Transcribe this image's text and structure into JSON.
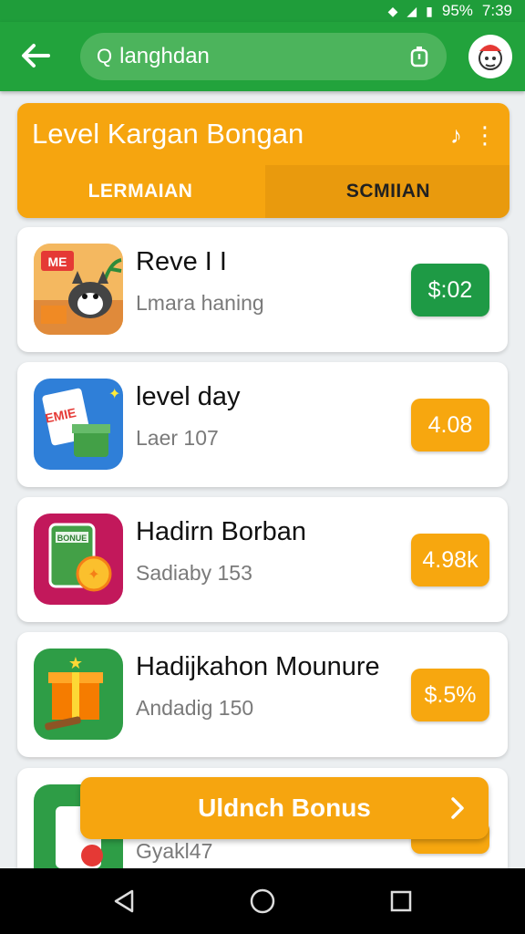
{
  "status_bar": {
    "battery": "95%",
    "time": "7:39"
  },
  "app_bar": {
    "search_value": "langhdan"
  },
  "header": {
    "title": "Level Kargan Bongan",
    "tabs": [
      {
        "label": "LERMAIAN"
      },
      {
        "label": "SCMIIAN"
      }
    ]
  },
  "items": [
    {
      "title": "Reve I I",
      "subtitle": "Lmara haning",
      "price": "$:02"
    },
    {
      "title": "level day",
      "subtitle": "Laer 107",
      "price": "4.08"
    },
    {
      "title": "Hadirn Borban",
      "subtitle": "Sadiaby 153",
      "price": "4.98k"
    },
    {
      "title": "Hadijkahon Mounure",
      "subtitle": "Andadig 150",
      "price": "$.5%"
    },
    {
      "title": "",
      "subtitle": "Gyakl47",
      "price": ""
    }
  ],
  "bonus_button": {
    "label": "Uldnch Bonus"
  },
  "colors": {
    "primary_green": "#22a33c",
    "accent_orange": "#f6a50f",
    "price_green": "#1e9a45"
  }
}
